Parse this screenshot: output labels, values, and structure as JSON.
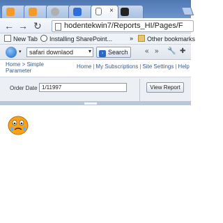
{
  "browser": {
    "tabs": [
      {
        "name": "tab-1",
        "active": false
      },
      {
        "name": "tab-2",
        "active": false
      },
      {
        "name": "tab-3",
        "active": false
      },
      {
        "name": "tab-4",
        "active": false
      },
      {
        "name": "tab-5",
        "active": true,
        "close": "×"
      },
      {
        "name": "tab-6",
        "active": false
      }
    ],
    "address": "hodentekwin7/Reports_HI/Pages/F",
    "bookmarks": {
      "new_tab": "New Tab",
      "installing": "Installing SharePoint...",
      "overflow": "»",
      "other": "Other bookmarks"
    }
  },
  "extension_toolbar": {
    "search_text": "safari downlaod",
    "search_button": "Search",
    "right_glyphs": [
      "«",
      "»"
    ]
  },
  "report_manager": {
    "breadcrumb": "Home > Simple Parameter",
    "links": {
      "home": "Home",
      "subscriptions": "My Subscriptions",
      "site_settings": "Site Settings",
      "help": "Help"
    },
    "parameter": {
      "label": "Order Date",
      "value": "1/11997"
    },
    "view_report": "View Report"
  },
  "colors": {
    "frame": "#6f95c9",
    "param_bg": "#eceff3",
    "link": "#3b5b8a"
  }
}
